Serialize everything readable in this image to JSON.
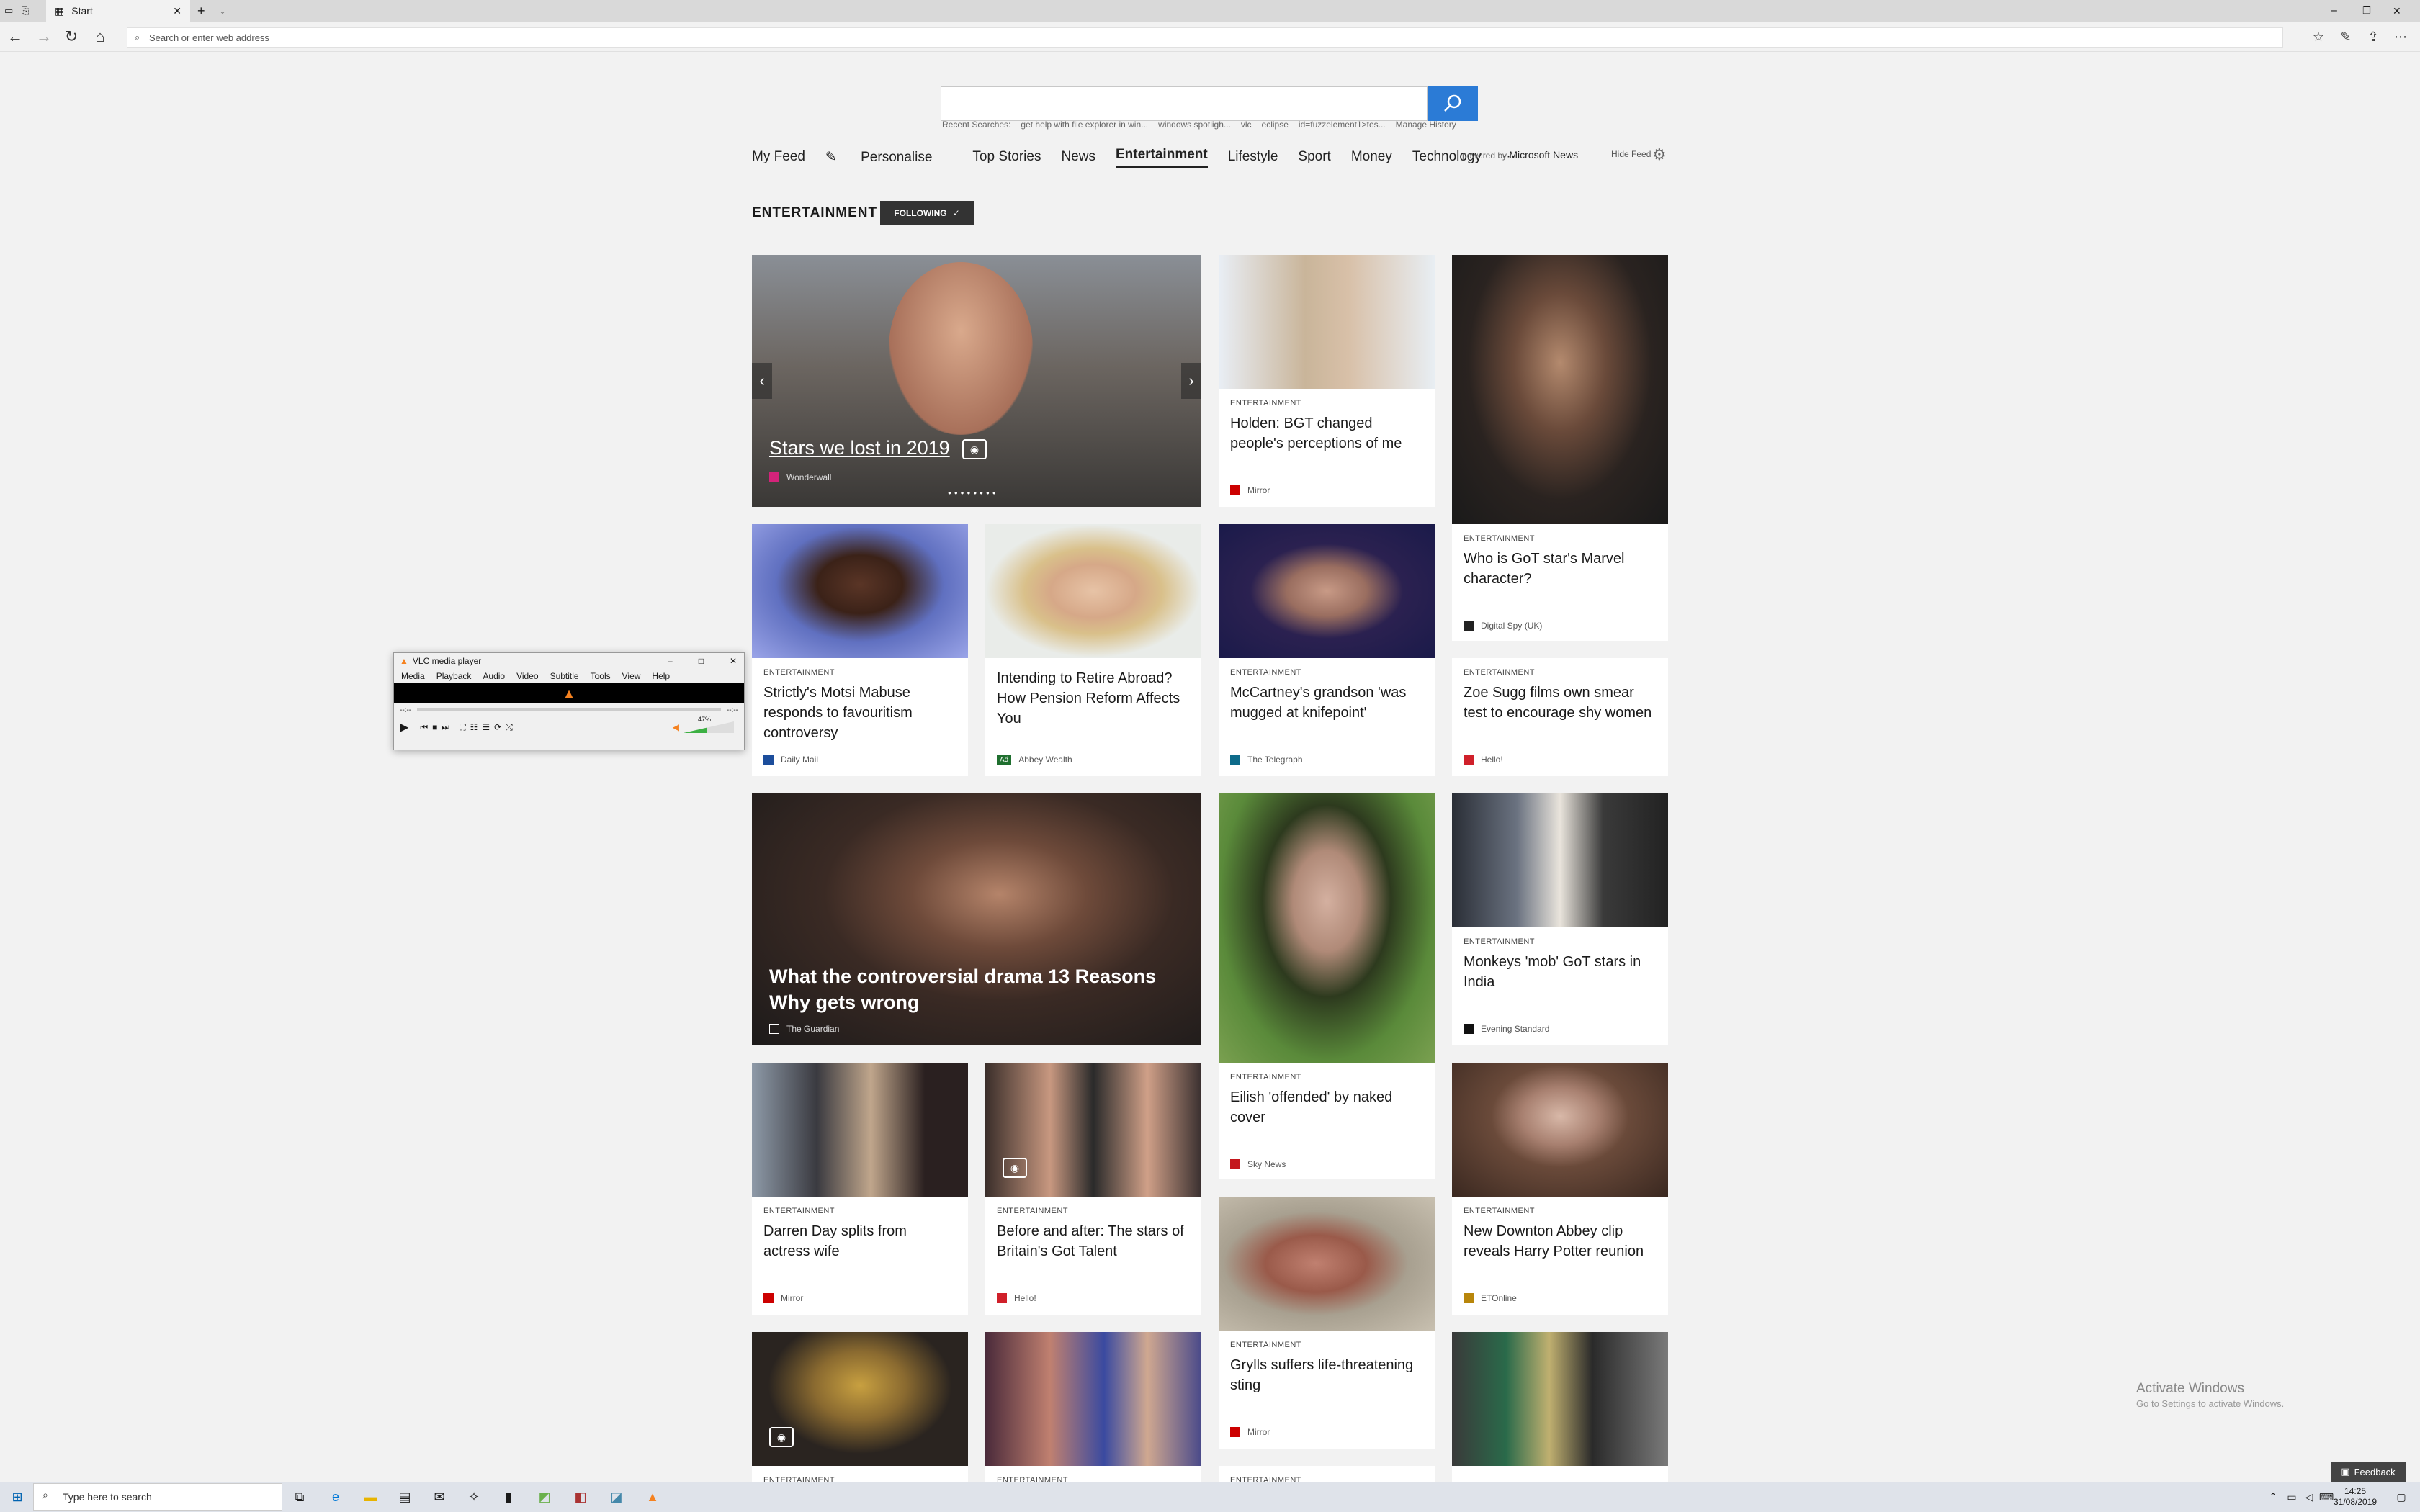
{
  "browser": {
    "tab_title": "Start",
    "address_placeholder": "Search or enter web address"
  },
  "search": {
    "placeholder": "",
    "recent_label": "Recent Searches:",
    "recent": [
      "get help with file explorer in win...",
      "windows spotligh...",
      "vlc",
      "eclipse",
      "id=fuzzelement1>tes..."
    ],
    "manage": "Manage History"
  },
  "nav": {
    "items": [
      "My Feed",
      "Personalise",
      "Top Stories",
      "News",
      "Entertainment",
      "Lifestyle",
      "Sport",
      "Money",
      "Technology",
      "···"
    ],
    "powered_prefix": "powered by",
    "powered_brand": "Microsoft News",
    "hide_feed": "Hide Feed"
  },
  "section": {
    "title": "ENTERTAINMENT",
    "following": "FOLLOWING"
  },
  "cards": {
    "hero": {
      "title": "Stars we lost in 2019",
      "source": "Wonderwall"
    },
    "c1": {
      "cat": "ENTERTAINMENT",
      "title": "Holden: BGT changed people's perceptions of me",
      "source": "Mirror"
    },
    "c2": {
      "cat": "ENTERTAINMENT",
      "title": "Who is GoT star's Marvel character?",
      "source": "Digital Spy (UK)"
    },
    "c3": {
      "cat": "ENTERTAINMENT",
      "title": "Strictly's Motsi Mabuse responds to favouritism controversy",
      "source": "Daily Mail"
    },
    "c4": {
      "title": "Intending to Retire Abroad? How Pension Reform Affects You",
      "ad": "Ad",
      "source": "Abbey Wealth"
    },
    "c5": {
      "cat": "ENTERTAINMENT",
      "title": "McCartney's grandson 'was mugged at knifepoint'",
      "source": "The Telegraph"
    },
    "c6": {
      "cat": "ENTERTAINMENT",
      "title": "Zoe Sugg films own smear test to encourage shy women",
      "source": "Hello!"
    },
    "c7": {
      "title": "What the controversial drama 13 Reasons Why gets wrong",
      "source": "The Guardian"
    },
    "c8": {
      "cat": "ENTERTAINMENT",
      "title": "Eilish 'offended' by naked cover",
      "source": "Sky News"
    },
    "c9": {
      "cat": "ENTERTAINMENT",
      "title": "Monkeys 'mob' GoT stars in India",
      "source": "Evening Standard"
    },
    "c10": {
      "cat": "ENTERTAINMENT",
      "title": "Darren Day splits from actress wife",
      "source": "Mirror"
    },
    "c11": {
      "cat": "ENTERTAINMENT",
      "title": "Before and after: The stars of Britain's Got Talent",
      "source": "Hello!"
    },
    "c12": {
      "cat": "ENTERTAINMENT",
      "title": "Grylls suffers life-threatening sting",
      "source": "Mirror"
    },
    "c13": {
      "cat": "ENTERTAINMENT",
      "title": "New Downton Abbey clip reveals Harry Potter reunion",
      "source": "ETOnline"
    },
    "c14": {
      "cat": "ENTERTAINMENT"
    },
    "c15": {
      "cat": "ENTERTAINMENT"
    },
    "c16": {
      "cat": "ENTERTAINMENT"
    }
  },
  "vlc": {
    "title": "VLC media player",
    "menu": [
      "Media",
      "Playback",
      "Audio",
      "Video",
      "Subtitle",
      "Tools",
      "View",
      "Help"
    ],
    "time_left": "--:--",
    "time_right": "--:--",
    "volume": "47%",
    "volume_level": 0.47
  },
  "system": {
    "activate_title": "Activate Windows",
    "activate_sub": "Go to Settings to activate Windows.",
    "feedback": "Feedback",
    "taskbar_search": "Type here to search",
    "time": "14:25",
    "date": "31/08/2019"
  },
  "colors": {
    "accent": "#2b7bd6",
    "vlc_orange": "#f58220"
  }
}
